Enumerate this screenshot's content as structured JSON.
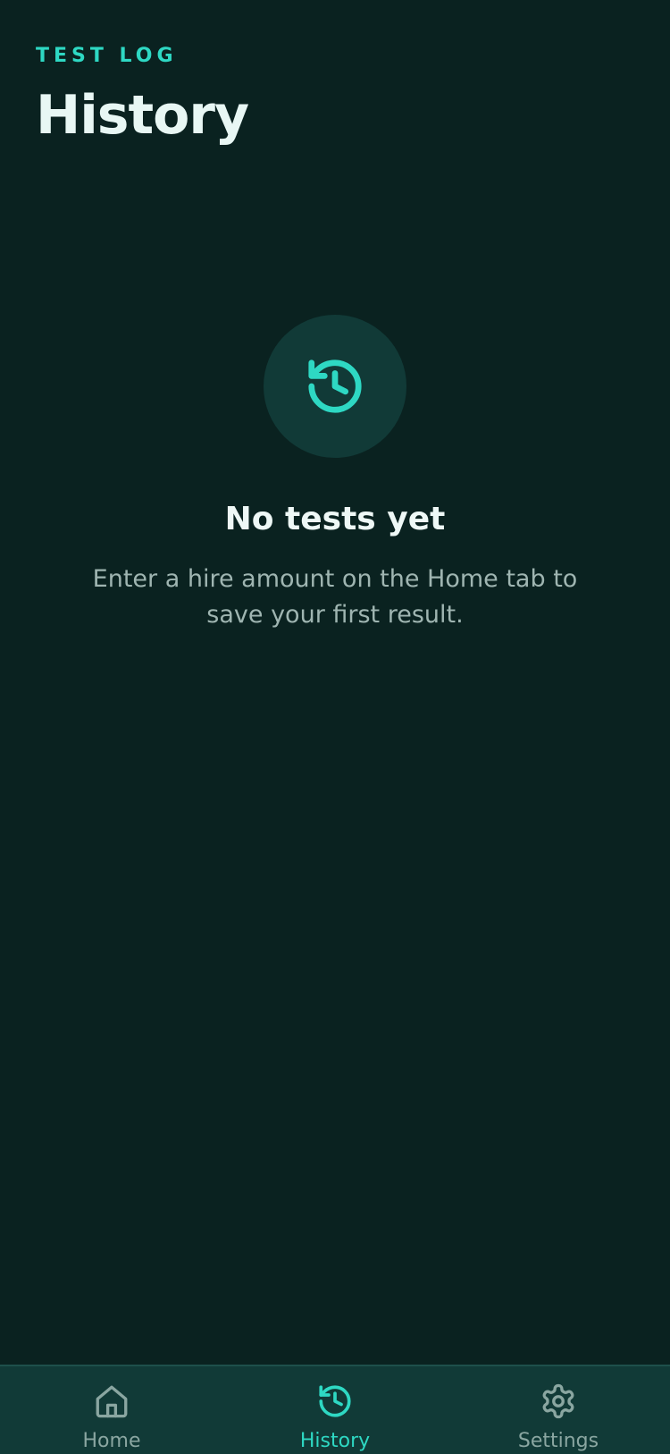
{
  "header": {
    "eyebrow": "TEST LOG",
    "title": "History"
  },
  "empty_state": {
    "icon": "history-icon",
    "title": "No tests yet",
    "message": "Enter a hire amount on the Home tab to save your first result."
  },
  "tabbar": {
    "items": [
      {
        "label": "Home",
        "icon": "home-icon",
        "active": false
      },
      {
        "label": "History",
        "icon": "history-icon",
        "active": true
      },
      {
        "label": "Settings",
        "icon": "gear-icon",
        "active": false
      }
    ]
  },
  "colors": {
    "background": "#0a2220",
    "surface": "#113a37",
    "accent": "#2ed8c3",
    "inactive": "#8aa6a1",
    "title": "#e8f7f4",
    "muted": "#9fb5b1"
  }
}
